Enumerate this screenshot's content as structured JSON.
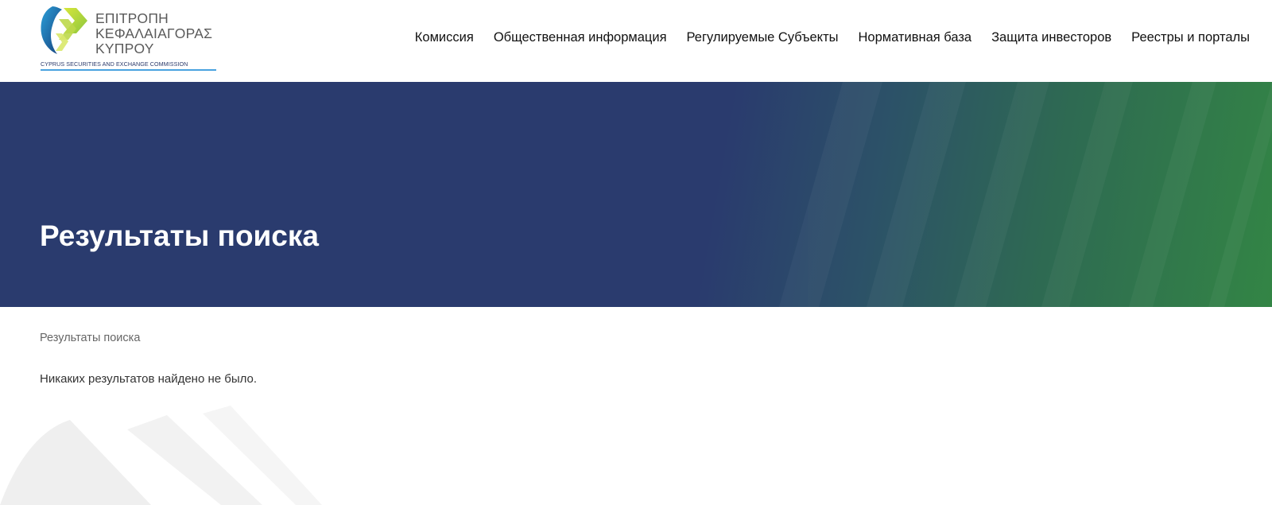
{
  "header": {
    "logo": {
      "lines": [
        "ΕΠΙΤΡΟΠΗ",
        "ΚΕΦΑΛΑΙΑΓΟΡΑΣ",
        "ΚΥΠΡΟΥ"
      ],
      "subtitle": "CYPRUS SECURITIES AND EXCHANGE COMMISSION"
    },
    "nav": [
      {
        "label": "Комиссия"
      },
      {
        "label": "Общественная информация"
      },
      {
        "label": "Регулируемые Субъекты"
      },
      {
        "label": "Нормативная база"
      },
      {
        "label": "Защита инвесторов"
      },
      {
        "label": "Реестры и порталы"
      }
    ]
  },
  "hero": {
    "title": "Результаты поиска"
  },
  "content": {
    "breadcrumb": "Результаты поиска",
    "message": "Никаких результатов найдено не было."
  },
  "colors": {
    "hero_navy": "#2a3b6e",
    "hero_green": "#338545",
    "logo_text": "#5a5a5a",
    "logo_accent_blue": "#1d7fc4",
    "logo_accent_lime": "#b5d334"
  }
}
